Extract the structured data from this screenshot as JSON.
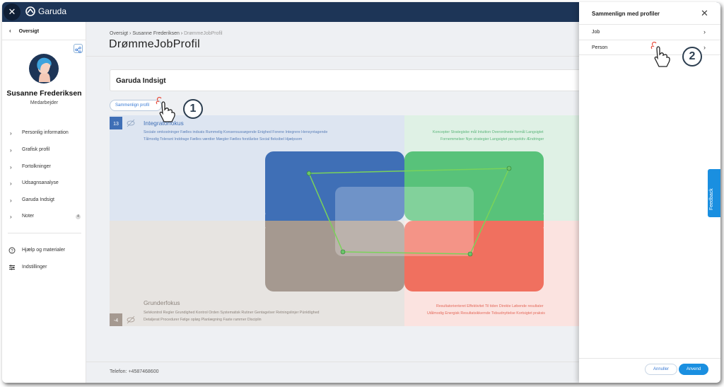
{
  "app": {
    "name": "Garuda",
    "close_glyph": "✕"
  },
  "sidebar": {
    "back_label": "Oversigt",
    "user_name": "Susanne Frederiksen",
    "user_role": "Medarbejder",
    "nav_items": [
      {
        "label": "Personlig information"
      },
      {
        "label": "Grafisk profil"
      },
      {
        "label": "Fortolkninger"
      },
      {
        "label": "Udsagnsanalyse"
      },
      {
        "label": "Garuda Indsigt"
      },
      {
        "label": "Noter",
        "count": "4"
      }
    ],
    "util_items": [
      {
        "label": "Hjælp og materialer",
        "icon": "help-circle-icon"
      },
      {
        "label": "Indstillinger",
        "icon": "sliders-icon"
      }
    ]
  },
  "breadcrumb": [
    "Oversigt",
    "Susanne Frederiksen",
    "DrømmeJobProfil"
  ],
  "breadcrumb_sep": "›",
  "page_title": "DrømmeJobProfil",
  "insight": {
    "title": "Garuda Indsigt",
    "compare_button": "Sammenlign profil"
  },
  "chart_data": {
    "type": "radar-quadrant",
    "top_left": {
      "badge": "13",
      "title": "Integratorfokus",
      "words": "Sociale omkostninger   Fælles indsats   Rummelig   Konsensussøgende   Enighed   Forene   Integrere   Hensyntagende",
      "words2": "Tålmodig   Tolerant   Inddrage   Fælles værdier   Mægler   Fælles forståelse   Social fleksibel   Hjælpsom"
    },
    "top_right": {
      "words": "Koncepter   Strategiske mål   Intuition   Overordnede formål   Langsigtet",
      "words2": "Fornemmelser   Nye strategier   Langsigtet perspektiv   Ændringer"
    },
    "bottom_left": {
      "badge": "-4",
      "title": "Grunderfokus",
      "words": "Selvkontrol   Regler   Grundighed   Kontrol   Orden   Systematisk   Rutiner   Gentagelser   Retningslinjer   Pünktlighed",
      "words2": "Detaljerat   Procedurer   Følge opløg   Planlægning   Faste rammer   Disciplin"
    },
    "bottom_right": {
      "words": "Resultatorienteret   Effektivitet   Til tiden   Direkte   Løbende resultater",
      "words2": "Utålmodig   Energisk   Resultatsikkernde   Tidsudnyttelse   Kortsigtet praksis"
    },
    "polygon_points": [
      {
        "quadrant": "blue",
        "x": -0.75,
        "y": 0.7
      },
      {
        "quadrant": "green",
        "x": 0.75,
        "y": 0.75
      },
      {
        "quadrant": "red",
        "x": 0.5,
        "y": -0.45
      },
      {
        "quadrant": "grey",
        "x": -0.45,
        "y": -0.45
      }
    ],
    "colors": {
      "blue": "#3f6fb6",
      "green": "#58c27a",
      "grey": "#a59990",
      "red": "#f0705f",
      "line": "#7ad35a"
    }
  },
  "footer": {
    "phone": "Telefon: +4587468600"
  },
  "panel": {
    "title": "Sammenlign med profiler",
    "close_glyph": "✕",
    "rows": [
      {
        "label": "Job"
      },
      {
        "label": "Person"
      }
    ],
    "cancel": "Annuller",
    "apply": "Anvend"
  },
  "feedback_label": "Feedback",
  "annotations": [
    "1",
    "2"
  ],
  "chev_right": "›",
  "chev_left": "‹"
}
